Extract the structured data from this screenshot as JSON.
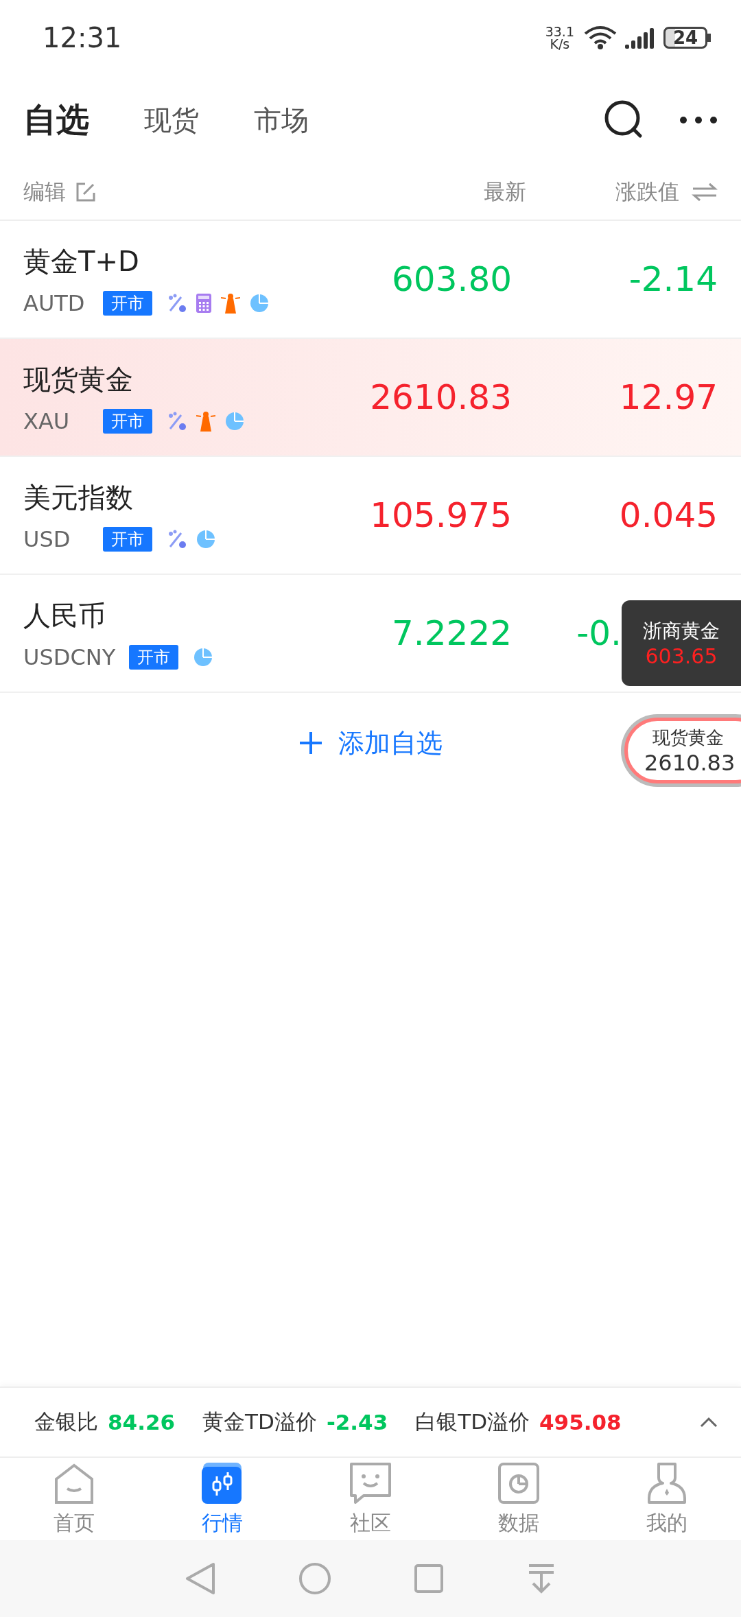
{
  "status_bar": {
    "time": "12:31",
    "net_speed": "33.1",
    "net_unit": "K/s",
    "battery": "24"
  },
  "tabs": [
    {
      "label": "自选",
      "selected": true
    },
    {
      "label": "现货",
      "selected": false
    },
    {
      "label": "市场",
      "selected": false
    }
  ],
  "header": {
    "edit": "编辑",
    "latest": "最新",
    "change": "涨跌值"
  },
  "rows": [
    {
      "name": "黄金T+D",
      "code": "AUTD",
      "status": "开市",
      "markers": [
        {
          "kind": "percent"
        },
        {
          "kind": "calculator"
        },
        {
          "kind": "beacon"
        },
        {
          "kind": "pie"
        }
      ],
      "price": "603.80",
      "change": "-2.14",
      "covered": false,
      "color": "#00c65e",
      "selected": false
    },
    {
      "name": "现货黄金",
      "code": "XAU",
      "status": "开市",
      "markers": [
        {
          "kind": "percent"
        },
        {
          "kind": "beacon"
        },
        {
          "kind": "pie"
        }
      ],
      "price": "2610.83",
      "change": "12.97",
      "covered": false,
      "color": "#f5222d",
      "selected": true
    },
    {
      "name": "美元指数",
      "code": "USD",
      "status": "开市",
      "markers": [
        {
          "kind": "percent"
        },
        {
          "kind": "pie"
        }
      ],
      "price": "105.975",
      "change": "0.045",
      "covered": false,
      "color": "#f5222d",
      "selected": false
    },
    {
      "name": "人民币",
      "code": "USDCNY",
      "status": "开市",
      "markers": [
        {
          "kind": "pie"
        }
      ],
      "price": "7.2222",
      "change": "-0.",
      "covered": true,
      "color": "#00c65e",
      "selected": false
    }
  ],
  "add_button": "添加自选",
  "float_tooltip": {
    "title": "浙商黄金",
    "value": "603.65"
  },
  "float_button": {
    "title": "现货黄金",
    "value": "2610.83"
  },
  "ticker": [
    {
      "label": "金银比",
      "value": "84.26",
      "color": "#00c65e"
    },
    {
      "label": "黄金TD溢价",
      "value": "-2.43",
      "color": "#00c65e"
    },
    {
      "label": "白银TD溢价",
      "value": "495.08",
      "color": "#f5222d"
    }
  ],
  "nav": [
    {
      "label": "首页",
      "kind": "home",
      "selected": false
    },
    {
      "label": "行情",
      "kind": "market",
      "selected": true
    },
    {
      "label": "社区",
      "kind": "community",
      "selected": false
    },
    {
      "label": "数据",
      "kind": "data",
      "selected": false
    },
    {
      "label": "我的",
      "kind": "profile",
      "selected": false
    }
  ]
}
